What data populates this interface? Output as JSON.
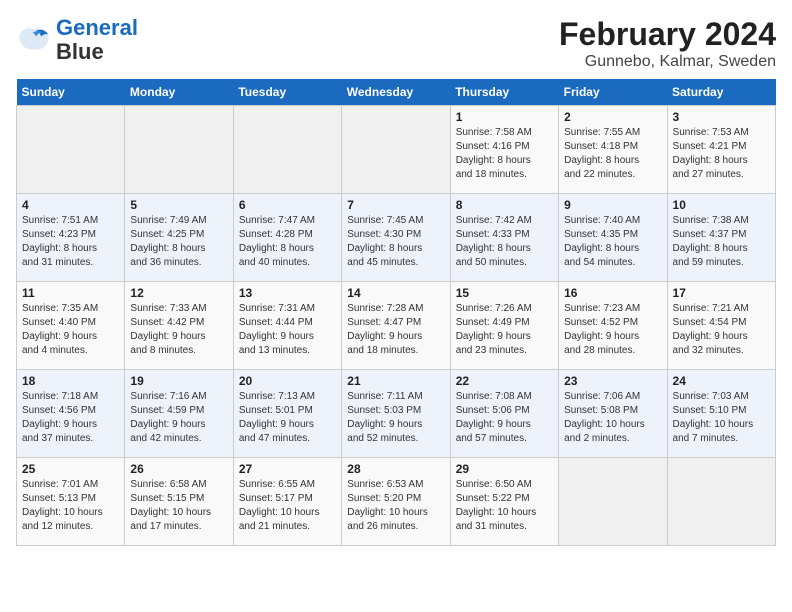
{
  "logo": {
    "line1": "General",
    "line2": "Blue"
  },
  "title": "February 2024",
  "subtitle": "Gunnebo, Kalmar, Sweden",
  "days_header": [
    "Sunday",
    "Monday",
    "Tuesday",
    "Wednesday",
    "Thursday",
    "Friday",
    "Saturday"
  ],
  "weeks": [
    [
      {
        "day": "",
        "info": ""
      },
      {
        "day": "",
        "info": ""
      },
      {
        "day": "",
        "info": ""
      },
      {
        "day": "",
        "info": ""
      },
      {
        "day": "1",
        "info": "Sunrise: 7:58 AM\nSunset: 4:16 PM\nDaylight: 8 hours\nand 18 minutes."
      },
      {
        "day": "2",
        "info": "Sunrise: 7:55 AM\nSunset: 4:18 PM\nDaylight: 8 hours\nand 22 minutes."
      },
      {
        "day": "3",
        "info": "Sunrise: 7:53 AM\nSunset: 4:21 PM\nDaylight: 8 hours\nand 27 minutes."
      }
    ],
    [
      {
        "day": "4",
        "info": "Sunrise: 7:51 AM\nSunset: 4:23 PM\nDaylight: 8 hours\nand 31 minutes."
      },
      {
        "day": "5",
        "info": "Sunrise: 7:49 AM\nSunset: 4:25 PM\nDaylight: 8 hours\nand 36 minutes."
      },
      {
        "day": "6",
        "info": "Sunrise: 7:47 AM\nSunset: 4:28 PM\nDaylight: 8 hours\nand 40 minutes."
      },
      {
        "day": "7",
        "info": "Sunrise: 7:45 AM\nSunset: 4:30 PM\nDaylight: 8 hours\nand 45 minutes."
      },
      {
        "day": "8",
        "info": "Sunrise: 7:42 AM\nSunset: 4:33 PM\nDaylight: 8 hours\nand 50 minutes."
      },
      {
        "day": "9",
        "info": "Sunrise: 7:40 AM\nSunset: 4:35 PM\nDaylight: 8 hours\nand 54 minutes."
      },
      {
        "day": "10",
        "info": "Sunrise: 7:38 AM\nSunset: 4:37 PM\nDaylight: 8 hours\nand 59 minutes."
      }
    ],
    [
      {
        "day": "11",
        "info": "Sunrise: 7:35 AM\nSunset: 4:40 PM\nDaylight: 9 hours\nand 4 minutes."
      },
      {
        "day": "12",
        "info": "Sunrise: 7:33 AM\nSunset: 4:42 PM\nDaylight: 9 hours\nand 8 minutes."
      },
      {
        "day": "13",
        "info": "Sunrise: 7:31 AM\nSunset: 4:44 PM\nDaylight: 9 hours\nand 13 minutes."
      },
      {
        "day": "14",
        "info": "Sunrise: 7:28 AM\nSunset: 4:47 PM\nDaylight: 9 hours\nand 18 minutes."
      },
      {
        "day": "15",
        "info": "Sunrise: 7:26 AM\nSunset: 4:49 PM\nDaylight: 9 hours\nand 23 minutes."
      },
      {
        "day": "16",
        "info": "Sunrise: 7:23 AM\nSunset: 4:52 PM\nDaylight: 9 hours\nand 28 minutes."
      },
      {
        "day": "17",
        "info": "Sunrise: 7:21 AM\nSunset: 4:54 PM\nDaylight: 9 hours\nand 32 minutes."
      }
    ],
    [
      {
        "day": "18",
        "info": "Sunrise: 7:18 AM\nSunset: 4:56 PM\nDaylight: 9 hours\nand 37 minutes."
      },
      {
        "day": "19",
        "info": "Sunrise: 7:16 AM\nSunset: 4:59 PM\nDaylight: 9 hours\nand 42 minutes."
      },
      {
        "day": "20",
        "info": "Sunrise: 7:13 AM\nSunset: 5:01 PM\nDaylight: 9 hours\nand 47 minutes."
      },
      {
        "day": "21",
        "info": "Sunrise: 7:11 AM\nSunset: 5:03 PM\nDaylight: 9 hours\nand 52 minutes."
      },
      {
        "day": "22",
        "info": "Sunrise: 7:08 AM\nSunset: 5:06 PM\nDaylight: 9 hours\nand 57 minutes."
      },
      {
        "day": "23",
        "info": "Sunrise: 7:06 AM\nSunset: 5:08 PM\nDaylight: 10 hours\nand 2 minutes."
      },
      {
        "day": "24",
        "info": "Sunrise: 7:03 AM\nSunset: 5:10 PM\nDaylight: 10 hours\nand 7 minutes."
      }
    ],
    [
      {
        "day": "25",
        "info": "Sunrise: 7:01 AM\nSunset: 5:13 PM\nDaylight: 10 hours\nand 12 minutes."
      },
      {
        "day": "26",
        "info": "Sunrise: 6:58 AM\nSunset: 5:15 PM\nDaylight: 10 hours\nand 17 minutes."
      },
      {
        "day": "27",
        "info": "Sunrise: 6:55 AM\nSunset: 5:17 PM\nDaylight: 10 hours\nand 21 minutes."
      },
      {
        "day": "28",
        "info": "Sunrise: 6:53 AM\nSunset: 5:20 PM\nDaylight: 10 hours\nand 26 minutes."
      },
      {
        "day": "29",
        "info": "Sunrise: 6:50 AM\nSunset: 5:22 PM\nDaylight: 10 hours\nand 31 minutes."
      },
      {
        "day": "",
        "info": ""
      },
      {
        "day": "",
        "info": ""
      }
    ]
  ]
}
